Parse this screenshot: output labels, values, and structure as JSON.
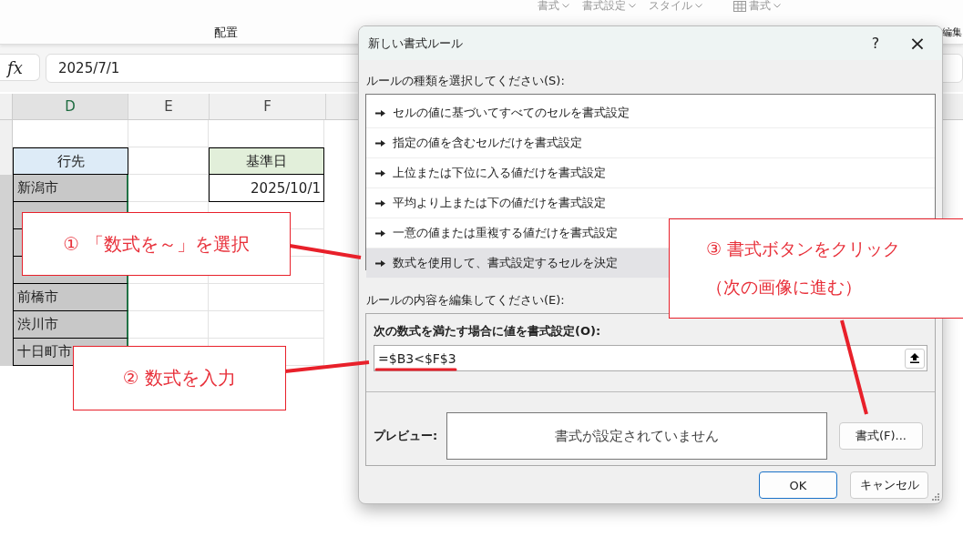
{
  "ribbon": {
    "top_items": [
      {
        "label": "書式",
        "kind": "dropdown"
      },
      {
        "label": "書式設定",
        "kind": "dropdown"
      },
      {
        "label": "スタイル",
        "kind": "dropdown"
      },
      {
        "label": "書式",
        "kind": "table"
      }
    ],
    "groups": [
      {
        "label": "配置"
      },
      {
        "label": "編集"
      }
    ]
  },
  "formula_bar": {
    "fx": "fx",
    "value": "2025/7/1"
  },
  "sheet": {
    "columns": [
      "D",
      "E",
      "F"
    ],
    "header_cell": "行先",
    "cells": [
      "新潟市",
      null,
      null,
      null,
      "前橋市",
      "渋川市",
      "十日町市"
    ],
    "ref_header": "基準日",
    "ref_value": "2025/10/1"
  },
  "dialog": {
    "title": "新しい書式ルール",
    "help": "?",
    "close": "×",
    "type_label": "ルールの種類を選択してください(S):",
    "rule_types": [
      {
        "label": "セルの値に基づいてすべてのセルを書式設定",
        "selected": false
      },
      {
        "label": "指定の値を含むセルだけを書式設定",
        "selected": false
      },
      {
        "label": "上位または下位に入る値だけを書式設定",
        "selected": false
      },
      {
        "label": "平均より上または下の値だけを書式設定",
        "selected": false
      },
      {
        "label": "一意の値または重複する値だけを書式設定",
        "selected": false
      },
      {
        "label": "数式を使用して、書式設定するセルを決定",
        "selected": true
      }
    ],
    "edit_label": "ルールの内容を編集してください(E):",
    "formula_label": "次の数式を満たす場合に値を書式設定(O):",
    "formula": "=$B3<$F$3",
    "preview_label": "プレビュー:",
    "preview_text": "書式が設定されていません",
    "format_button": "書式(F)...",
    "ok": "OK",
    "cancel": "キャンセル"
  },
  "callouts": [
    {
      "lines": [
        "① 「数式を～」を選択"
      ]
    },
    {
      "lines": [
        "② 数式を入力"
      ]
    },
    {
      "lines": [
        "③ 書式ボタンをクリック",
        "（次の画像に進む）"
      ]
    }
  ]
}
